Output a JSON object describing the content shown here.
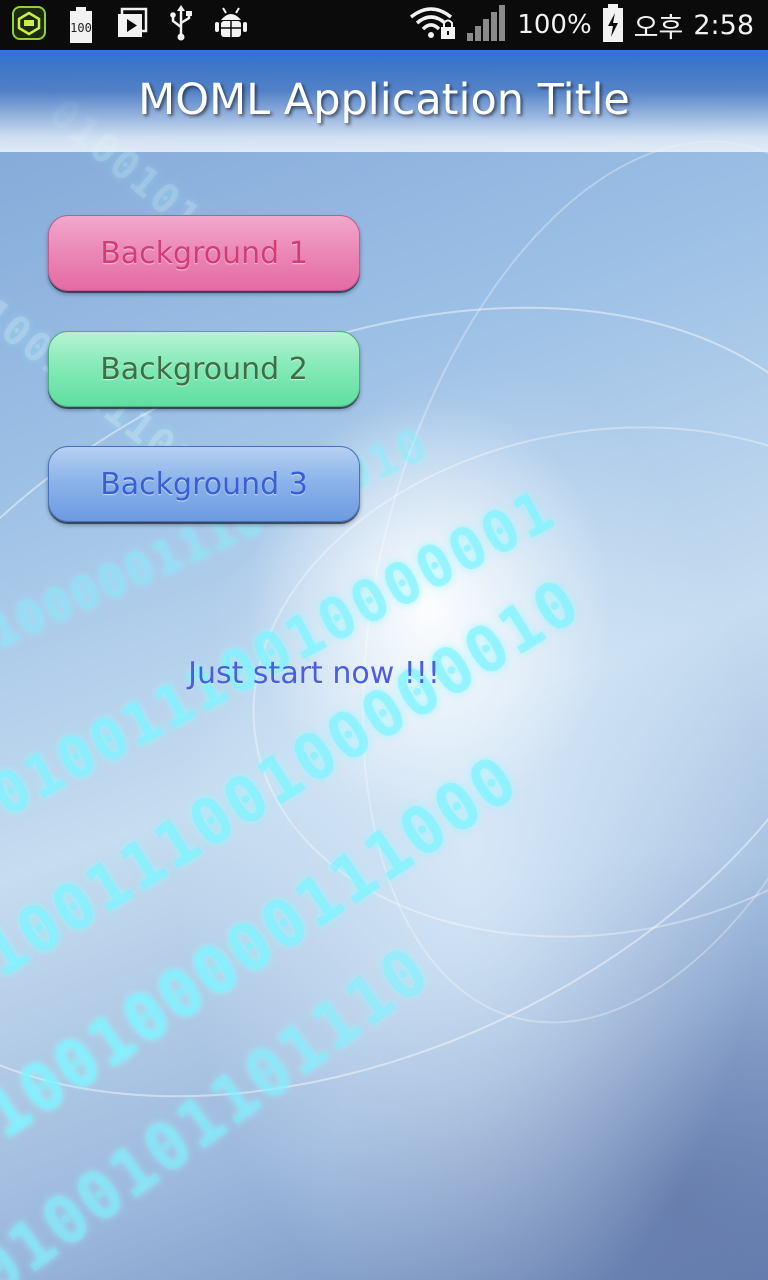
{
  "status_bar": {
    "icons": [
      "app-icon",
      "battery-100-icon",
      "media-play-icon",
      "usb-icon",
      "android-debug-icon",
      "wifi-lock-icon",
      "signal-icon",
      "battery-charging-icon"
    ],
    "battery_label": "100",
    "battery_percent": "100%",
    "ampm": "오후",
    "time": "2:58"
  },
  "header": {
    "title": "MOML Application Title"
  },
  "buttons": [
    {
      "label": "Background 1",
      "color": "#e46aa4",
      "text_color": "#d23d78"
    },
    {
      "label": "Background 2",
      "color": "#5fdf9f",
      "text_color": "#3f6e44"
    },
    {
      "label": "Background 3",
      "color": "#6c9be0",
      "text_color": "#3a5fd2"
    }
  ],
  "message": "Just start now !!!"
}
